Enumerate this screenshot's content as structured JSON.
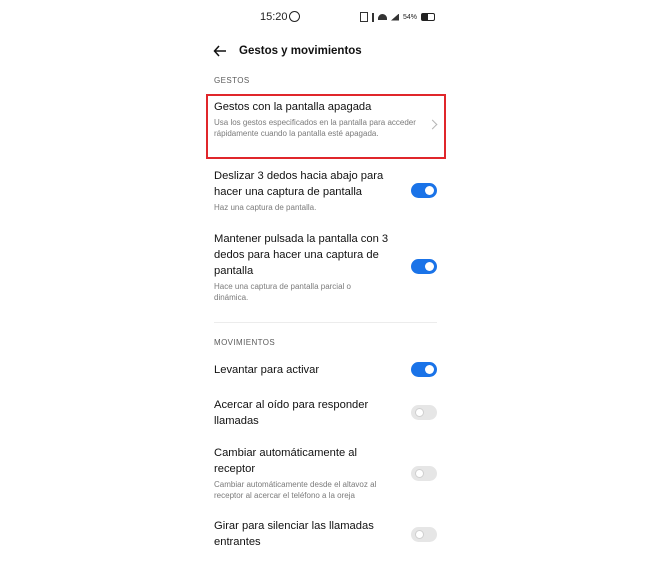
{
  "status": {
    "time": "15:20",
    "battery": "54%"
  },
  "header": {
    "title": "Gestos y movimientos"
  },
  "sections": {
    "gestures": {
      "label": "GESTOS",
      "items": [
        {
          "title": "Gestos con la pantalla apagada",
          "subtitle": "Usa los gestos especificados en la pantalla para acceder rápidamente cuando la pantalla esté apagada.",
          "control": "chevron"
        },
        {
          "title": "Deslizar 3 dedos hacia abajo para hacer una captura de pantalla",
          "subtitle": "Haz una captura de pantalla.",
          "control": "toggle",
          "enabled": true
        },
        {
          "title": "Mantener pulsada la pantalla con 3 dedos para hacer una captura de pantalla",
          "subtitle": "Hace una captura de pantalla parcial o dinámica.",
          "control": "toggle",
          "enabled": true
        }
      ]
    },
    "movements": {
      "label": "MOVIMIENTOS",
      "items": [
        {
          "title": "Levantar para activar",
          "subtitle": "",
          "control": "toggle",
          "enabled": true
        },
        {
          "title": "Acercar al oído para responder llamadas",
          "subtitle": "",
          "control": "toggle",
          "enabled": false
        },
        {
          "title": "Cambiar automáticamente al receptor",
          "subtitle": "Cambiar automáticamente desde el altavoz al receptor al acercar el teléfono a la oreja",
          "control": "toggle",
          "enabled": false
        },
        {
          "title": "Girar para silenciar las llamadas entrantes",
          "subtitle": "",
          "control": "toggle",
          "enabled": false
        }
      ]
    }
  },
  "colors": {
    "accent": "#1a73e8",
    "highlight": "#e0262b"
  }
}
